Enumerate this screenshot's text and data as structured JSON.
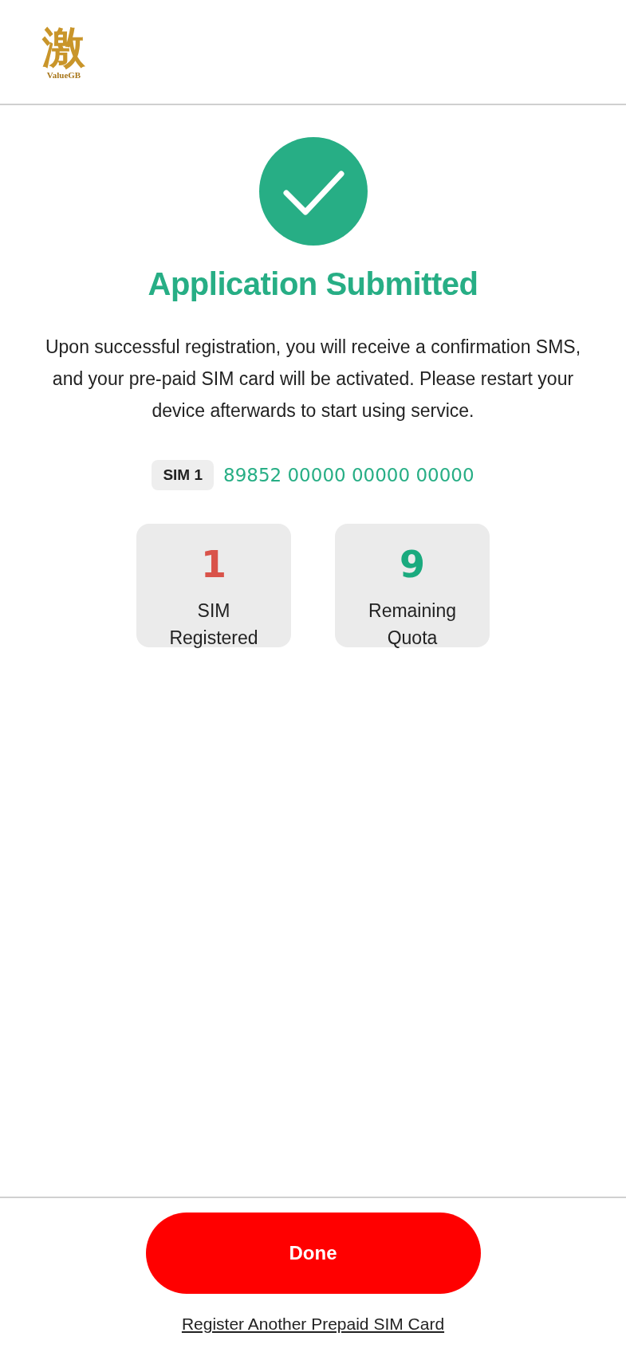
{
  "logo": {
    "mark": "激",
    "name": "ValueGB"
  },
  "title": "Application Submitted",
  "message": "Upon successful registration, you will receive a confirmation SMS, and your pre-paid SIM card will be activated. Please restart your device afterwards to start using service.",
  "sim": {
    "label": "SIM 1",
    "number": "89852 00000 00000 00000"
  },
  "stats": [
    {
      "value": "1",
      "label": "SIM Registered",
      "color": "#d9534a"
    },
    {
      "value": "9",
      "label": "Remaining Quota",
      "color": "#1aaa7e"
    }
  ],
  "done_button": "Done",
  "register_link": "Register Another Prepaid SIM Card"
}
